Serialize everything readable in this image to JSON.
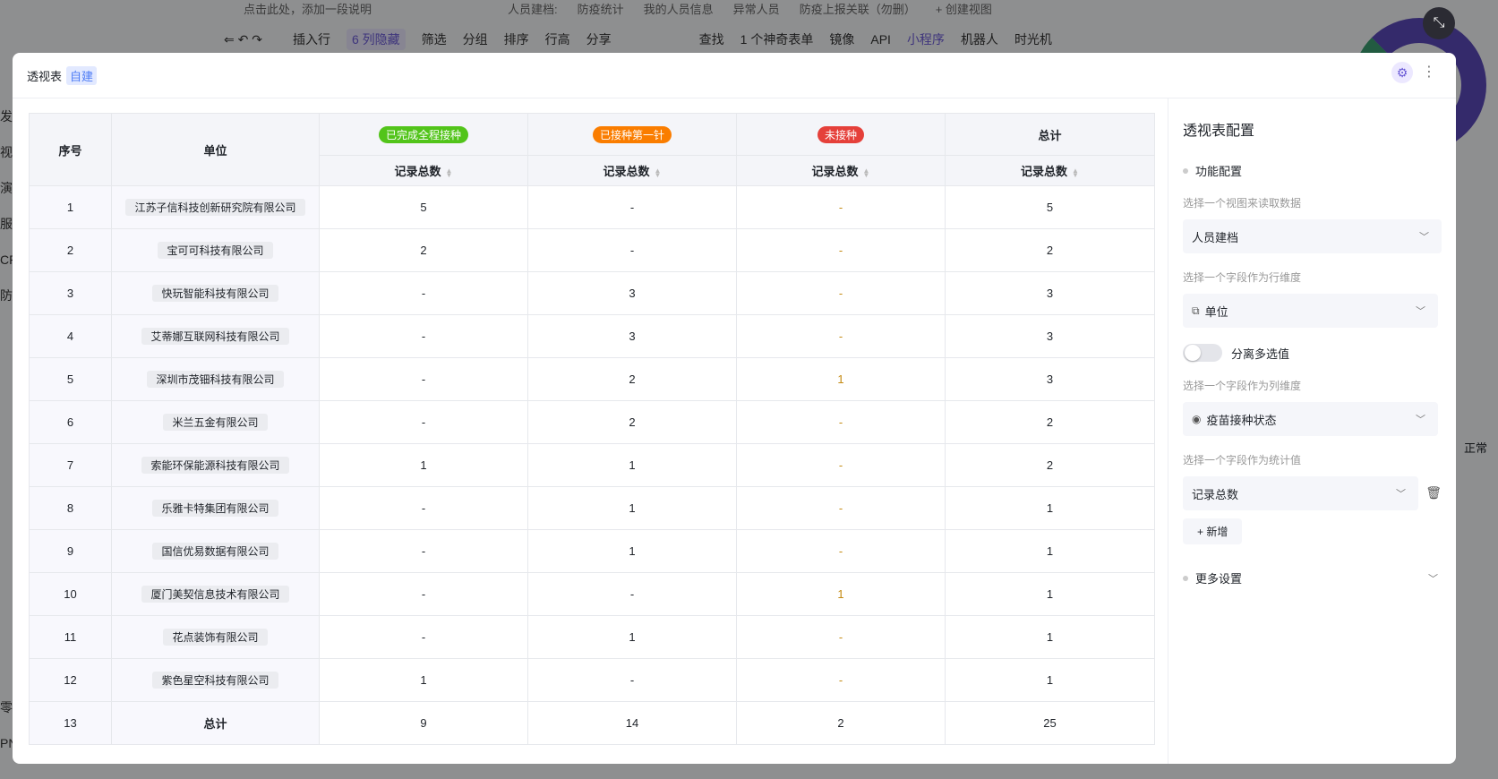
{
  "background": {
    "description_hint": "点击此处，添加一段说明",
    "view_tabs": [
      "人员建档:",
      "防疫统计",
      "我的人员信息",
      "异常人员",
      "防疫上报关联（勿删）",
      "+ 创建视图"
    ],
    "toolbar": [
      "插入行",
      "6 列隐藏",
      "筛选",
      "分组",
      "排序",
      "行高",
      "分享",
      "查找",
      "1 个神奇表单",
      "镜像",
      "API",
      "小程序",
      "机器人",
      "时光机"
    ],
    "side_items": [
      "发",
      "视",
      "演",
      "服",
      "CR",
      "防",
      "零",
      "PN"
    ],
    "legend_label": "正常"
  },
  "modal": {
    "title": "透视表",
    "tag": "自建",
    "table": {
      "headers": {
        "index": "序号",
        "unit": "单位",
        "total": "总计",
        "metric": "记录总数"
      },
      "groups": [
        {
          "label": "已完成全程接种",
          "color": "#52c41a"
        },
        {
          "label": "已接种第一针",
          "color": "#fa7d00"
        },
        {
          "label": "未接种",
          "color": "#e5403a"
        }
      ],
      "rows": [
        {
          "idx": "1",
          "unit": "江苏子信科技创新研究院有限公司",
          "v": [
            "5",
            "-",
            "-",
            "5"
          ]
        },
        {
          "idx": "2",
          "unit": "宝可可科技有限公司",
          "v": [
            "2",
            "-",
            "-",
            "2"
          ]
        },
        {
          "idx": "3",
          "unit": "快玩智能科技有限公司",
          "v": [
            "-",
            "3",
            "-",
            "3"
          ]
        },
        {
          "idx": "4",
          "unit": "艾蒂娜互联网科技有限公司",
          "v": [
            "-",
            "3",
            "-",
            "3"
          ]
        },
        {
          "idx": "5",
          "unit": "深圳市茂钿科技有限公司",
          "v": [
            "-",
            "2",
            "1",
            "3"
          ]
        },
        {
          "idx": "6",
          "unit": "米兰五金有限公司",
          "v": [
            "-",
            "2",
            "-",
            "2"
          ]
        },
        {
          "idx": "7",
          "unit": "索能环保能源科技有限公司",
          "v": [
            "1",
            "1",
            "-",
            "2"
          ]
        },
        {
          "idx": "8",
          "unit": "乐雅卡特集团有限公司",
          "v": [
            "-",
            "1",
            "-",
            "1"
          ]
        },
        {
          "idx": "9",
          "unit": "国信优易数据有限公司",
          "v": [
            "-",
            "1",
            "-",
            "1"
          ]
        },
        {
          "idx": "10",
          "unit": "厦门美契信息技术有限公司",
          "v": [
            "-",
            "-",
            "1",
            "1"
          ]
        },
        {
          "idx": "11",
          "unit": "花点装饰有限公司",
          "v": [
            "-",
            "1",
            "-",
            "1"
          ]
        },
        {
          "idx": "12",
          "unit": "紫色星空科技有限公司",
          "v": [
            "1",
            "-",
            "-",
            "1"
          ]
        }
      ],
      "total_row": {
        "idx": "13",
        "unit": "总计",
        "v": [
          "9",
          "14",
          "2",
          "25"
        ]
      }
    },
    "config": {
      "title": "透视表配置",
      "section_function": "功能配置",
      "view_label": "选择一个视图来读取数据",
      "view_value": "人员建档",
      "row_label": "选择一个字段作为行维度",
      "row_value": "单位",
      "split_toggle_label": "分离多选值",
      "split_toggle_on": false,
      "col_label": "选择一个字段作为列维度",
      "col_value": "疫苗接种状态",
      "stat_label": "选择一个字段作为统计值",
      "stat_value": "记录总数",
      "add_label": "+ 新增",
      "section_more": "更多设置"
    }
  }
}
